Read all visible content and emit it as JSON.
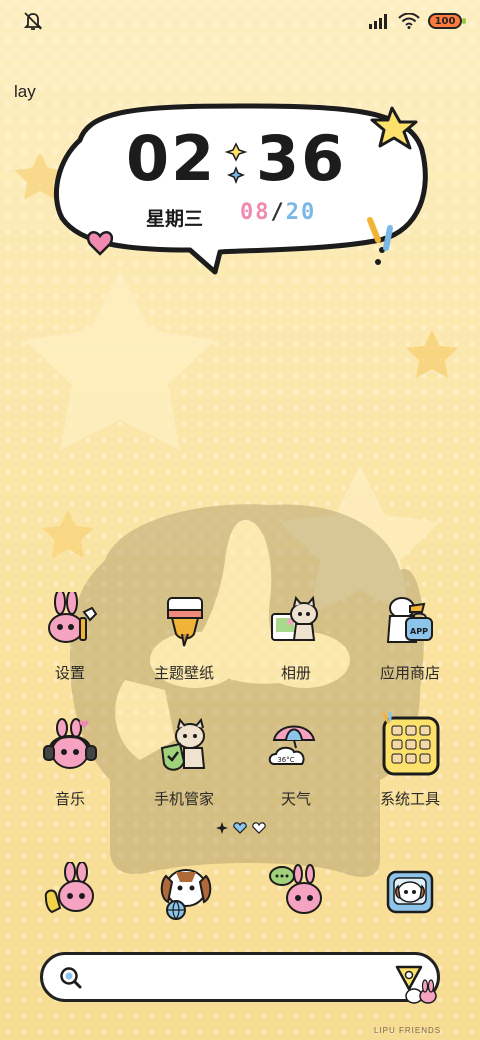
{
  "status_bar": {
    "left_icon": "mute-notification-icon",
    "right_icons": [
      "signal-icon",
      "wifi-icon",
      "battery-icon"
    ],
    "battery_level": "100"
  },
  "user_label": "lay",
  "clock_widget": {
    "hours": "02",
    "minutes": "36",
    "weekday": "星期三",
    "date_month": "08",
    "date_separator": "/",
    "date_day": "20"
  },
  "apps_row1": [
    {
      "label": "设置",
      "icon": "bunny-settings-icon"
    },
    {
      "label": "主题壁纸",
      "icon": "paint-brush-icon"
    },
    {
      "label": "相册",
      "icon": "cat-photo-icon"
    },
    {
      "label": "应用商店",
      "icon": "duck-app-bag-icon"
    }
  ],
  "apps_row2": [
    {
      "label": "音乐",
      "icon": "headphones-bunny-icon"
    },
    {
      "label": "手机管家",
      "icon": "cat-shield-icon"
    },
    {
      "label": "天气",
      "icon": "umbrella-cloud-icon"
    },
    {
      "label": "系统工具",
      "icon": "tools-folder-icon"
    }
  ],
  "weather_icon_text": "36°C",
  "appstore_icon_text": "APP",
  "dock_apps": [
    {
      "icon": "phone-bunny-icon"
    },
    {
      "icon": "dog-globe-icon"
    },
    {
      "icon": "chat-bunny-icon"
    },
    {
      "icon": "dog-camera-icon"
    }
  ],
  "search": {
    "placeholder": ""
  },
  "watermark": "LIPU FRIENDS",
  "colors": {
    "background": "#fbe6a6",
    "date_month": "#f08ab0",
    "date_day": "#7ab8e6",
    "text_dark": "#1c1c1c"
  }
}
